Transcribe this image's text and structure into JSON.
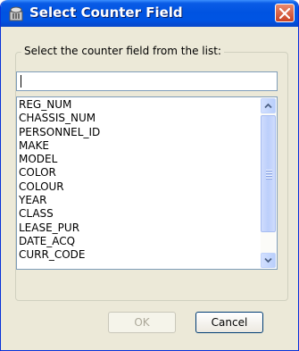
{
  "window": {
    "title": "Select Counter Field",
    "icon": "database-app-icon",
    "close_icon": "close-icon"
  },
  "group": {
    "legend": "Select the counter field from the list:"
  },
  "filter": {
    "value": ""
  },
  "list": {
    "items": [
      "REG_NUM",
      "CHASSIS_NUM",
      "PERSONNEL_ID",
      "MAKE",
      "MODEL",
      "COLOR",
      "COLOUR",
      "YEAR",
      "CLASS",
      "LEASE_PUR",
      "DATE_ACQ",
      "CURR_CODE"
    ]
  },
  "buttons": {
    "ok_label": "OK",
    "cancel_label": "Cancel"
  },
  "colors": {
    "titlebar": "#0054e3",
    "close_button": "#d85a3a",
    "dialog_bg": "#ece9d8"
  }
}
